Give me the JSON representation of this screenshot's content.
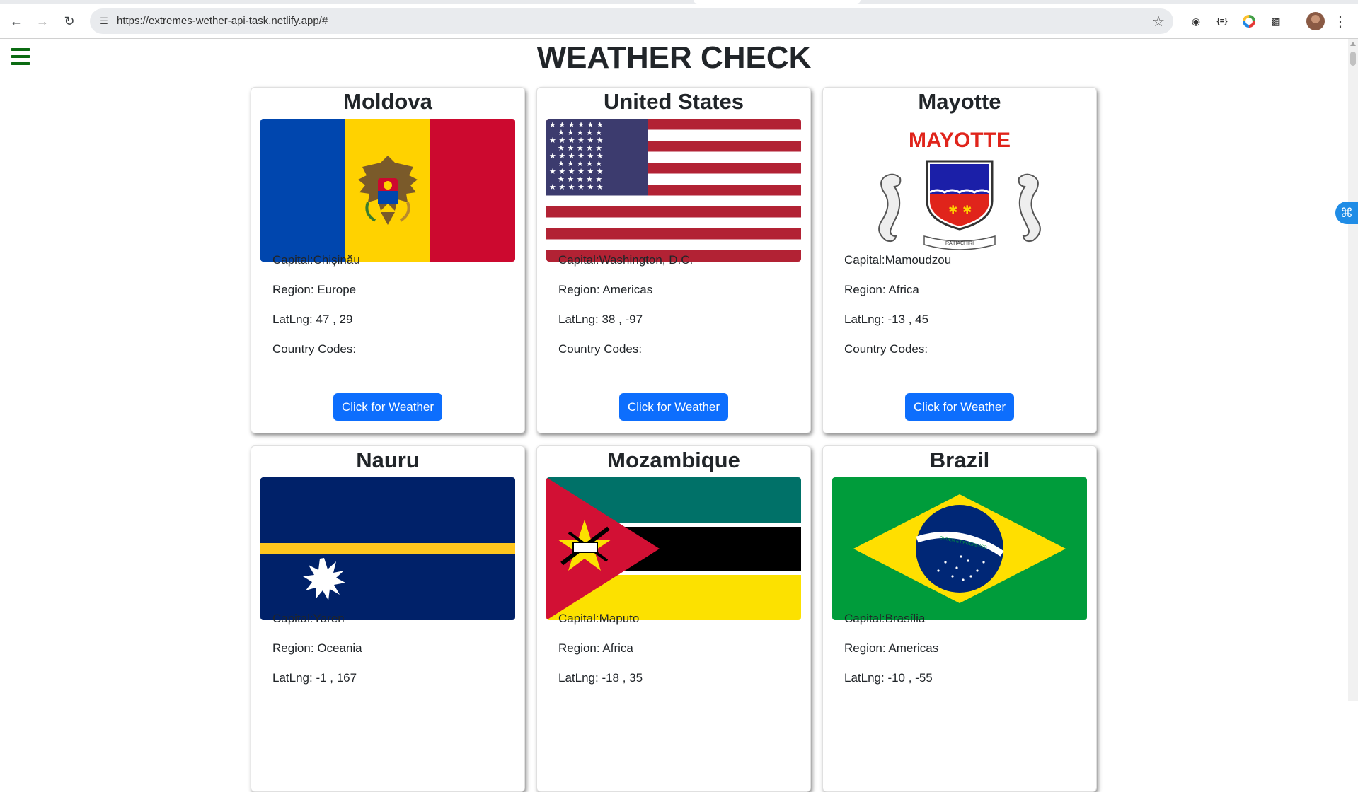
{
  "browser": {
    "url": "https://extremes-wether-api-task.netlify.app/#"
  },
  "page": {
    "title": "WEATHER CHECK"
  },
  "labels": {
    "capital": "Capital:",
    "region": "Region: ",
    "latlng": "LatLng: ",
    "codes": "Country Codes:",
    "button": "Click for Weather"
  },
  "cards": [
    {
      "name": "Moldova",
      "capital": "Capital:Chișinău",
      "region": "Region: Europe",
      "latlng": "LatLng: 47 , 29",
      "codes": "Country Codes:",
      "button": "Click for Weather"
    },
    {
      "name": "United States",
      "capital": "Capital:Washington, D.C.",
      "region": "Region: Americas",
      "latlng": "LatLng: 38 , -97",
      "codes": "Country Codes:",
      "button": "Click for Weather"
    },
    {
      "name": "Mayotte",
      "capital": "Capital:Mamoudzou",
      "region": "Region: Africa",
      "latlng": "LatLng: -13 , 45",
      "codes": "Country Codes:",
      "button": "Click for Weather",
      "flag_text": "MAYOTTE",
      "motto": "RA HACHIRI"
    },
    {
      "name": "Nauru",
      "capital": "Capital:Yaren",
      "region": "Region: Oceania",
      "latlng": "LatLng: -1 , 167"
    },
    {
      "name": "Mozambique",
      "capital": "Capital:Maputo",
      "region": "Region: Africa",
      "latlng": "LatLng: -18 , 35"
    },
    {
      "name": "Brazil",
      "capital": "Capital:Brasília",
      "region": "Region: Americas",
      "latlng": "LatLng: -10 , -55",
      "motto": "ORDEM E PROGRESSO"
    }
  ],
  "colors": {
    "button": "#0d6efd",
    "hamburger": "#0b6b12",
    "text": "#212529"
  }
}
